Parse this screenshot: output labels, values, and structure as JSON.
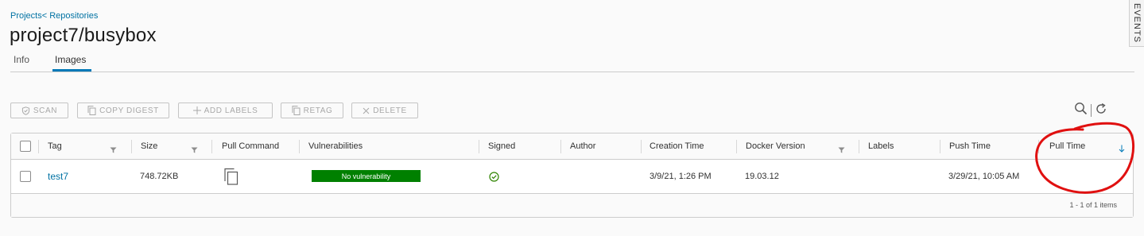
{
  "breadcrumb": {
    "projects": "Projects",
    "repositories": "< Repositories"
  },
  "page_title": "project7/busybox",
  "tabs": [
    {
      "label": "Info",
      "active": false
    },
    {
      "label": "Images",
      "active": true
    }
  ],
  "events_panel": {
    "label": "EVENTS"
  },
  "toolbar": {
    "scan": "SCAN",
    "copy_digest": "COPY DIGEST",
    "add_labels": "ADD LABELS",
    "retag": "RETAG",
    "delete": "DELETE"
  },
  "table": {
    "columns": {
      "tag": "Tag",
      "size": "Size",
      "pull_command": "Pull Command",
      "vulnerabilities": "Vulnerabilities",
      "signed": "Signed",
      "author": "Author",
      "creation_time": "Creation Time",
      "docker_version": "Docker Version",
      "labels": "Labels",
      "push_time": "Push Time",
      "pull_time": "Pull Time"
    },
    "sort": {
      "column": "Pull Time",
      "direction": "descending"
    },
    "rows": [
      {
        "tag": "test7",
        "size": "748.72KB",
        "vulnerabilities": "No vulnerability",
        "signed": true,
        "author": "",
        "creation_time": "3/9/21, 1:26 PM",
        "docker_version": "19.03.12",
        "labels": "",
        "push_time": "3/29/21, 10:05 AM",
        "pull_time": ""
      }
    ],
    "pagination": "1 - 1 of 1 items"
  },
  "colors": {
    "link": "#0072a3",
    "accent": "#0079b8",
    "vulnerability_ok": "#008000",
    "signed_ok": "#2f8400",
    "annotation": "#e01010"
  },
  "icons": [
    "scan-shield-icon",
    "copy-icon",
    "plus-icon",
    "retag-icon",
    "close-icon",
    "search-icon",
    "refresh-icon",
    "filter-icon",
    "sort-down-icon",
    "check-circle-icon"
  ]
}
